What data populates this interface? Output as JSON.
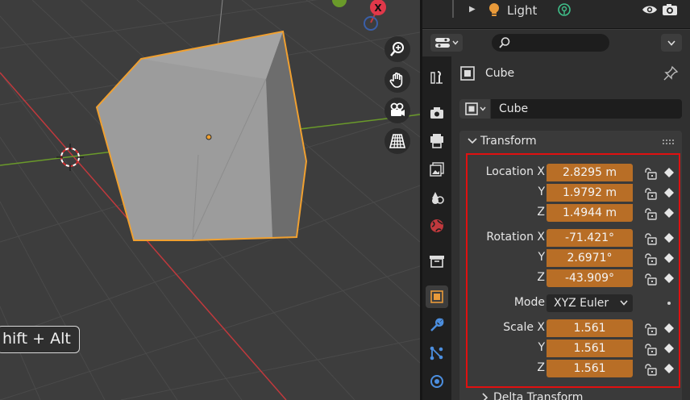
{
  "viewport": {
    "key_hint": "hift + Alt",
    "gizmo_x_label": "X"
  },
  "outliner": {
    "item_label": "Light"
  },
  "properties": {
    "object_name_header": "Cube",
    "object_name_field": "Cube",
    "transform_panel_title": "Transform",
    "location": {
      "label_x": "Location X",
      "label_y": "Y",
      "label_z": "Z",
      "x": "2.8295 m",
      "y": "1.9792 m",
      "z": "1.4944 m"
    },
    "rotation": {
      "label_x": "Rotation X",
      "label_y": "Y",
      "label_z": "Z",
      "x": "-71.421°",
      "y": "2.6971°",
      "z": "-43.909°"
    },
    "mode": {
      "label": "Mode",
      "value": "XYZ Euler"
    },
    "scale": {
      "label_x": "Scale X",
      "label_y": "Y",
      "label_z": "Z",
      "x": "1.561",
      "y": "1.561",
      "z": "1.561"
    },
    "delta_transform_title": "Delta Transform"
  },
  "colors": {
    "selection_outline": "#f0a030",
    "animated_field": "#b86e26",
    "highlight_box": "#e01010",
    "x_axis": "#c0393d",
    "y_axis": "#6a9a2a"
  }
}
